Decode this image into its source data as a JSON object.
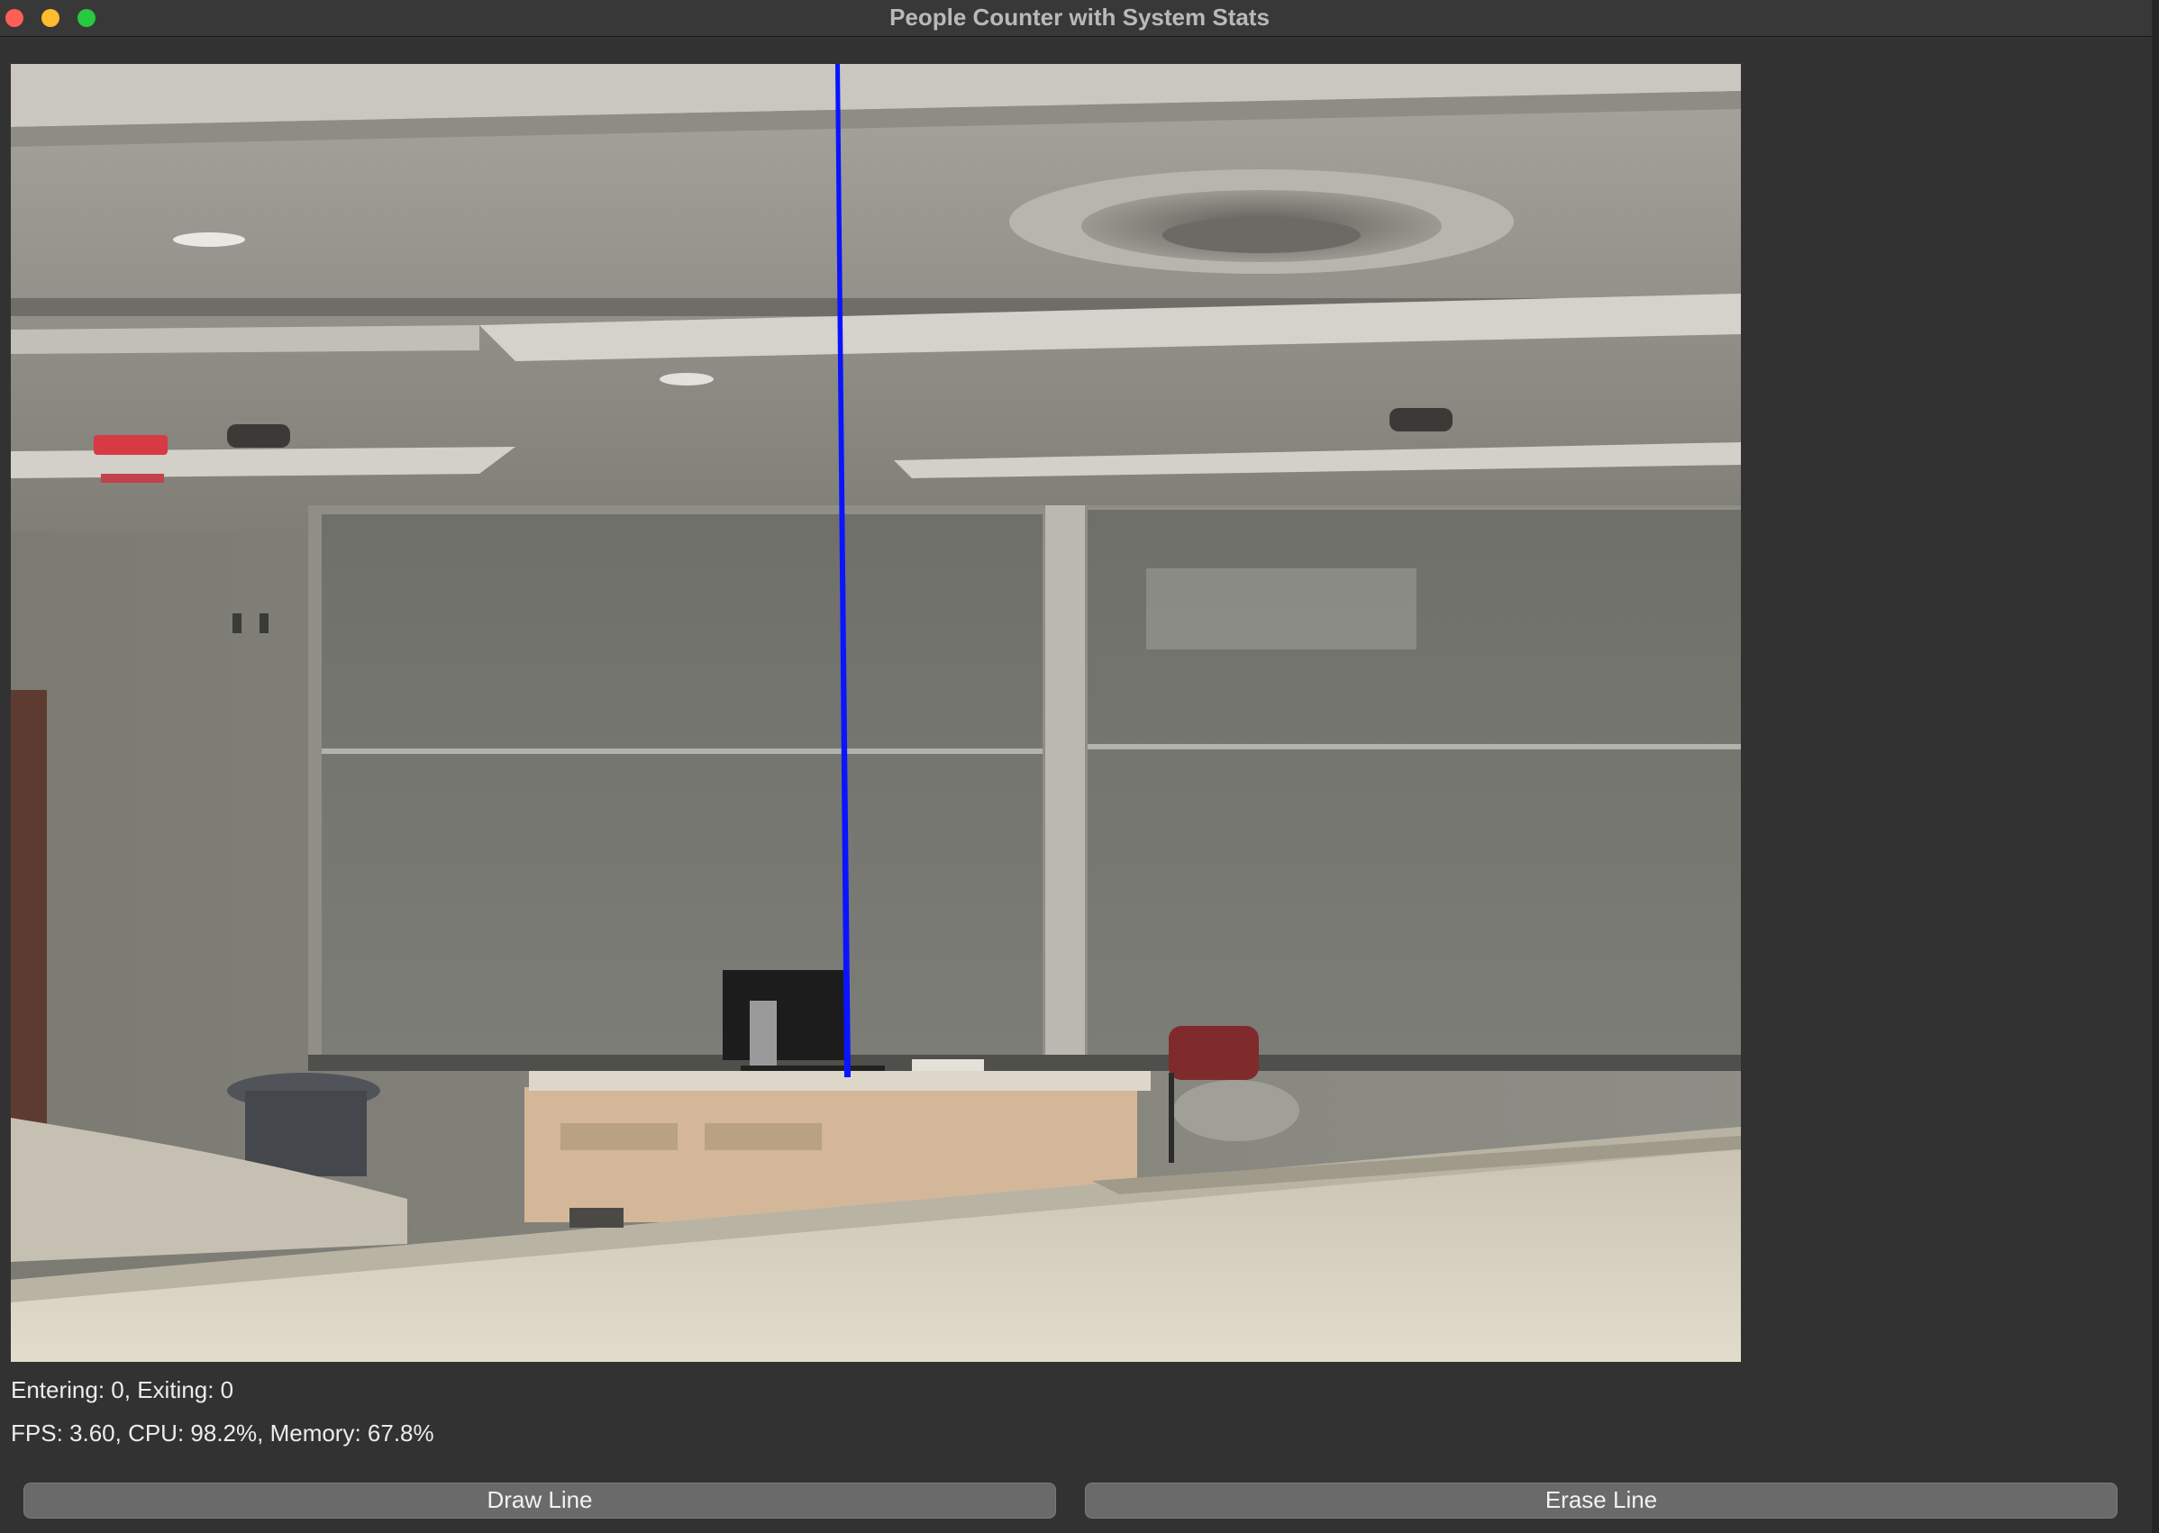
{
  "window": {
    "title": "People Counter with System Stats"
  },
  "video": {
    "scene": "camera-feed-classroom",
    "counting_line_color": "#0a14ff"
  },
  "stats": {
    "counts_text": "Entering: 0, Exiting: 0",
    "system_text": "FPS: 3.60, CPU: 98.2%, Memory: 67.8%"
  },
  "buttons": {
    "draw_line": "Draw Line",
    "erase_line": "Erase Line"
  },
  "colors": {
    "background": "#323232",
    "button": "#6a6a6a",
    "close": "#fe5f57",
    "minimize": "#febc2e",
    "maximize": "#28c840"
  }
}
